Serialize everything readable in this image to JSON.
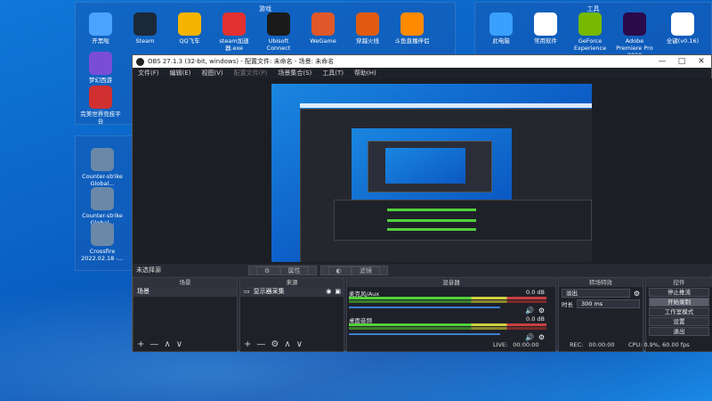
{
  "desktop": {
    "groups": {
      "games_title": "游戏",
      "tools_title": "工具"
    },
    "games_icons": [
      {
        "label": "开黑啦",
        "icon": "chat-bubble-icon",
        "color": "#4aa3ff"
      },
      {
        "label": "Steam",
        "icon": "steam-icon",
        "color": "#1b2838"
      },
      {
        "label": "QQ飞车",
        "icon": "qq-speed-icon",
        "color": "#f5b400"
      },
      {
        "label": "steam加速器.exe",
        "icon": "accelerator-icon",
        "color": "#e33030"
      },
      {
        "label": "Ubisoft Connect",
        "icon": "ubisoft-icon",
        "color": "#1a1a1a"
      },
      {
        "label": "WeGame",
        "icon": "wegame-icon",
        "color": "#e0572a"
      },
      {
        "label": "穿越火线",
        "icon": "crossfire-icon",
        "color": "#e05b10"
      },
      {
        "label": "斗鱼直播伴侣",
        "icon": "douyu-icon",
        "color": "#ff8a00"
      },
      {
        "label": "梦幻西游",
        "icon": "menghuan-icon",
        "color": "#7a4dd8"
      },
      {
        "label": "完美世界竞技平台",
        "icon": "perfect-world-icon",
        "color": "#d03030"
      }
    ],
    "cs_icons": [
      {
        "label": "Counter-strike Global...",
        "icon": "cs-shortcut-icon"
      },
      {
        "label": "Counter-strike Global...",
        "icon": "cs-shortcut-icon"
      },
      {
        "label": "Crossfire 2022.02.18 -...",
        "icon": "crossfire-video-icon"
      }
    ],
    "tools_icons": [
      {
        "label": "此电脑",
        "icon": "computer-icon",
        "color": "#3aa0ff"
      },
      {
        "label": "常用软件",
        "icon": "folder-icon",
        "color": "#ffffff"
      },
      {
        "label": "GeForce Experience",
        "icon": "geforce-icon",
        "color": "#76b900"
      },
      {
        "label": "Adobe Premiere Pro 2020",
        "icon": "premiere-icon",
        "color": "#2a0a4a"
      },
      {
        "label": "全键(v0.16)",
        "icon": "keyboard-icon",
        "color": "#ffffff"
      }
    ]
  },
  "obs": {
    "title": "OBS 27.1.3 (32-bit, windows) - 配置文件: 未命名 - 场景: 未命名",
    "window_buttons": [
      "—",
      "□",
      "✕"
    ],
    "menu": [
      "文件(F)",
      "编辑(E)",
      "视图(V)",
      "配置文件(P)",
      "场景集合(S)",
      "工具(T)",
      "帮助(H)"
    ],
    "scene_header_label": "未选择源",
    "scene_toolbar": [
      "属性",
      "滤镜"
    ],
    "docks": {
      "scenes": {
        "title": "场景",
        "items": [
          "场景"
        ]
      },
      "sources": {
        "title": "来源",
        "items": [
          "显示器采集"
        ]
      },
      "mixer": {
        "title": "混音器",
        "tracks": [
          {
            "name": "麦克风/Aux",
            "db": "0.0 dB"
          },
          {
            "name": "桌面音频",
            "db": "0.0 dB"
          }
        ]
      },
      "transitions": {
        "title": "转场特效",
        "type": "淡出",
        "duration_label": "时长",
        "duration_value": "300 ms"
      },
      "controls": {
        "title": "控件",
        "buttons": [
          "停止推流",
          "开始录制",
          "工作室模式",
          "设置",
          "退出"
        ]
      }
    },
    "status": {
      "live_label": "LIVE:",
      "live_time": "00:00:00",
      "rec_label": "REC:",
      "rec_time": "00:00:00",
      "cpu": "CPU: 0.9%, 60.00 fps"
    }
  }
}
